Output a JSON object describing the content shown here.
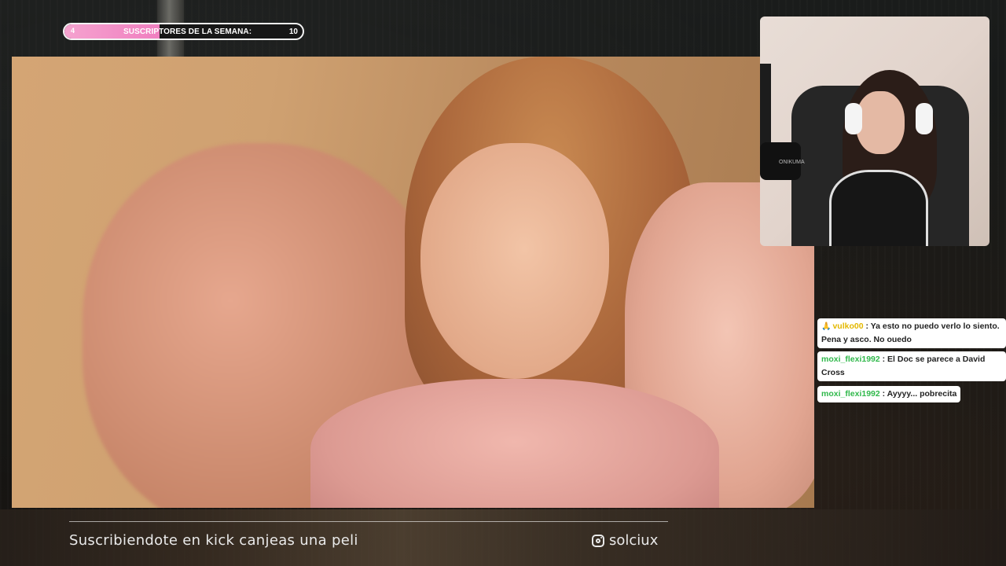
{
  "goal": {
    "current": "4",
    "label": "SUSCRIPTORES DE LA SEMANA:",
    "target": "10",
    "progress": 0.4,
    "fill_color": "#f07fc0"
  },
  "chat": {
    "messages": [
      {
        "badge_icon": "hand-icon",
        "badge": "🙏",
        "user": "vulko00",
        "user_color": "#e3b800",
        "text": " : Ya esto no puedo verlo lo siento. Pena y asco. No ouedo"
      },
      {
        "badge": "",
        "user": "moxi_flexi1992",
        "user_color": "#2fb84a",
        "text": " : El Doc se parece a David Cross"
      },
      {
        "badge": "",
        "user": "moxi_flexi1992",
        "user_color": "#2fb84a",
        "text": " : Ayyyy... pobrecita"
      }
    ]
  },
  "webcam": {
    "mic_brand": "ONIKUMA"
  },
  "footer": {
    "promo_text": "Suscribiendote en kick canjeas una peli",
    "instagram_handle": "solciux",
    "instagram_icon": "instagram-icon"
  }
}
